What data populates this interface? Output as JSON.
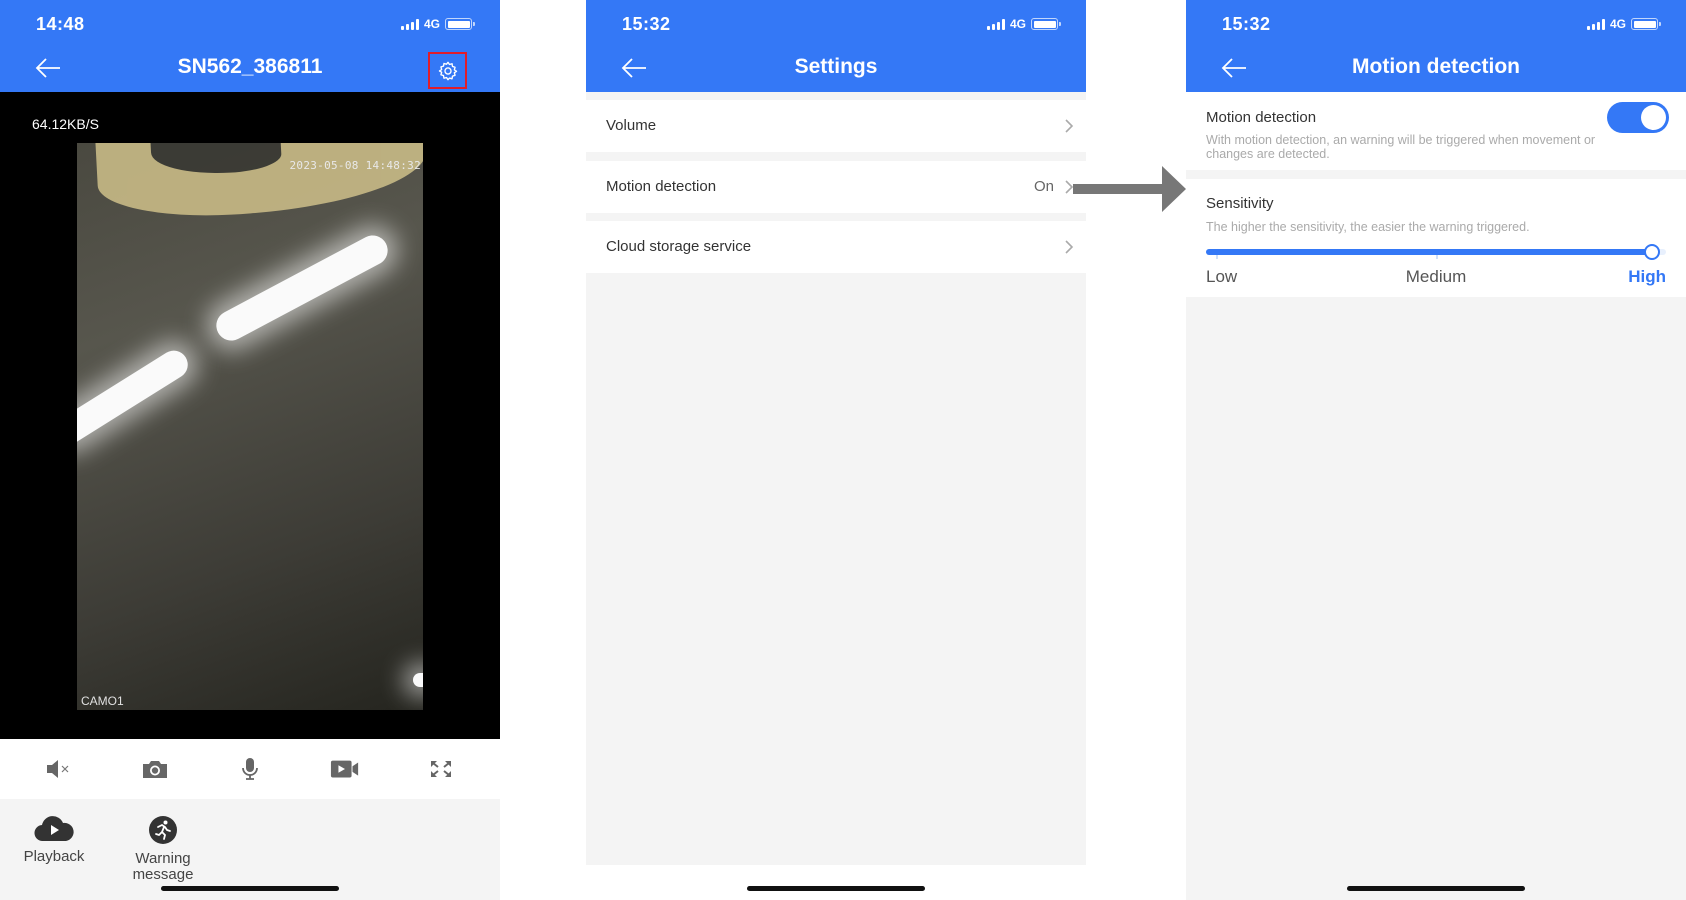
{
  "colors": {
    "brand_blue": "#3478f6",
    "highlight_red": "#e11d2a",
    "arrow_gray": "#777777"
  },
  "live_view": {
    "status_bar": {
      "time": "14:48",
      "network": "4G"
    },
    "title": "SN562_386811",
    "back_icon": "arrow-left-icon",
    "settings_icon": "gear-icon",
    "bitrate": "64.12KB/S",
    "video": {
      "osd_timestamp": "2023-05-08 14:48:32",
      "camera_label": "CAMO1"
    },
    "toolbar": [
      {
        "name": "mute",
        "icon": "speaker-muted-icon"
      },
      {
        "name": "snapshot",
        "icon": "camera-icon"
      },
      {
        "name": "talk",
        "icon": "microphone-icon"
      },
      {
        "name": "record",
        "icon": "video-record-icon"
      },
      {
        "name": "fullscreen",
        "icon": "fullscreen-icon"
      }
    ],
    "actions": [
      {
        "label": "Playback",
        "icon": "cloud-play-icon"
      },
      {
        "label_line1": "Warning",
        "label_line2": "message",
        "icon": "running-person-icon"
      }
    ]
  },
  "settings": {
    "status_bar": {
      "time": "15:32",
      "network": "4G"
    },
    "title": "Settings",
    "rows": [
      {
        "label": "Volume",
        "value": ""
      },
      {
        "label": "Motion detection",
        "value": "On"
      },
      {
        "label": "Cloud storage service",
        "value": ""
      }
    ]
  },
  "motion_detection": {
    "status_bar": {
      "time": "15:32",
      "network": "4G"
    },
    "title": "Motion detection",
    "toggle": {
      "label": "Motion detection",
      "description": "With motion detection, an warning will be triggered when movement or changes are detected.",
      "enabled": true
    },
    "sensitivity": {
      "label": "Sensitivity",
      "description": "The higher the sensitivity, the easier the warning triggered.",
      "levels": [
        "Low",
        "Medium",
        "High"
      ],
      "selected": "High",
      "value_fraction": 0.97
    }
  }
}
